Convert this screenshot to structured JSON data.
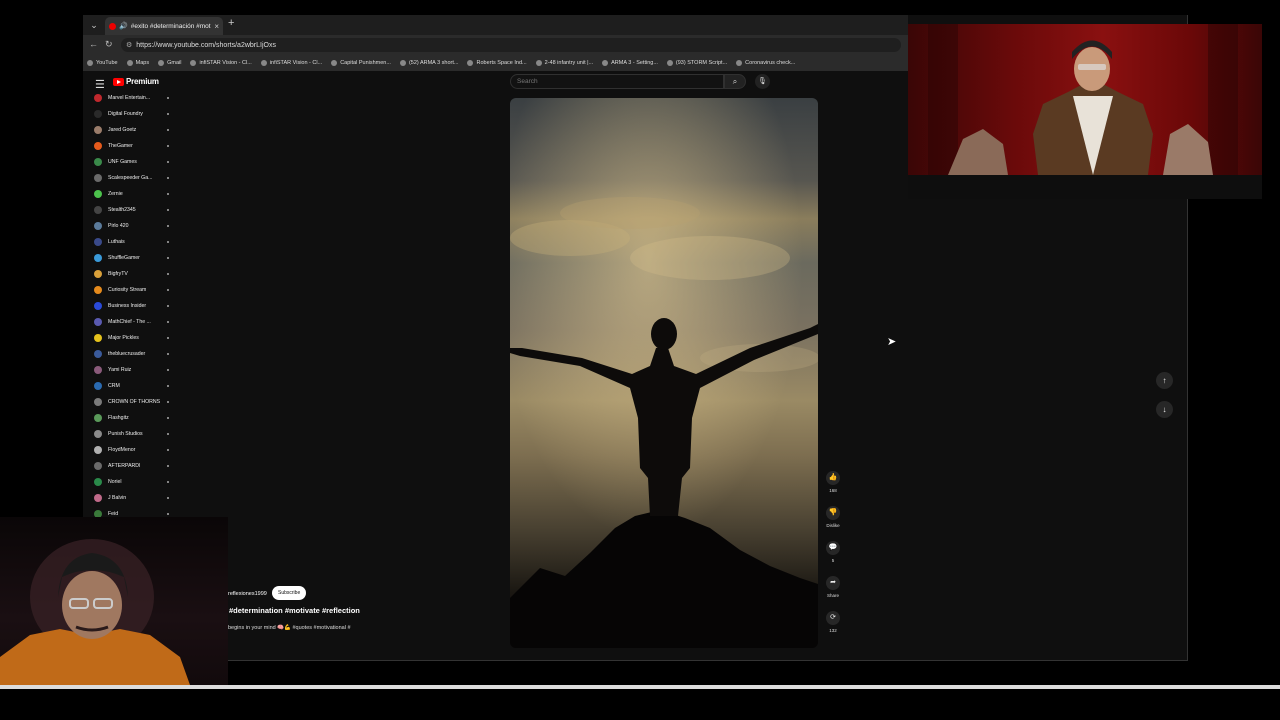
{
  "browser": {
    "tab_title": "#exito #determinación #moti",
    "url": "https://www.youtube.com/shorts/a2wbrLIjOxs",
    "bookmarks": [
      "YouTube",
      "Maps",
      "Gmail",
      "infiSTAR Vision - Cl...",
      "infiSTAR Vision - Cl...",
      "Capital Punishmen...",
      "(52) ARMA 3 short...",
      "Roberts Space Ind...",
      "2-48 infantry unit |...",
      "ARMA 3 - Setting...",
      "(93) STORM Script...",
      "Coronavirus check..."
    ]
  },
  "youtube": {
    "logo_text": "Premium",
    "search_placeholder": "Search",
    "sidebar": [
      {
        "name": "Marvel Entertain...",
        "color": "#c0282d"
      },
      {
        "name": "Digital Foundry",
        "color": "#2a2a2a"
      },
      {
        "name": "Jared Goetz",
        "color": "#9a7c6a"
      },
      {
        "name": "TheGamer",
        "color": "#e55a1c"
      },
      {
        "name": "UNF Games",
        "color": "#3a8a4a"
      },
      {
        "name": "Scalespeeder Ga...",
        "color": "#6a6a6a"
      },
      {
        "name": "Zernie",
        "color": "#4cc24c"
      },
      {
        "name": "Stealth2345",
        "color": "#444444"
      },
      {
        "name": "Pirlo 420",
        "color": "#5a7a9a"
      },
      {
        "name": "Luthais",
        "color": "#3a4a8a"
      },
      {
        "name": "ShuffleGamer",
        "color": "#3a9ad9"
      },
      {
        "name": "BigfryTV",
        "color": "#d9a03a"
      },
      {
        "name": "Curiosity Stream",
        "color": "#e58a1c"
      },
      {
        "name": "Business Insider",
        "color": "#2a4ad9"
      },
      {
        "name": "MathChief - The ...",
        "color": "#5a5ab0"
      },
      {
        "name": "Major Pickles",
        "color": "#e5c21c"
      },
      {
        "name": "thebluecrusader",
        "color": "#3a5a9a"
      },
      {
        "name": "Yami Ruiz",
        "color": "#8a5a7a"
      },
      {
        "name": "CRM",
        "color": "#2a6ab0"
      },
      {
        "name": "CROWN OF THORNS",
        "color": "#7a7a7a"
      },
      {
        "name": "Flashgitz",
        "color": "#5a9a5a"
      },
      {
        "name": "Punish Studios",
        "color": "#8a8a8a"
      },
      {
        "name": "FloydMenor",
        "color": "#b0b0b0"
      },
      {
        "name": "AFTERPARDI",
        "color": "#6a6a6a"
      },
      {
        "name": "Noriel",
        "color": "#2a8a4a"
      },
      {
        "name": "J Balvin",
        "color": "#c06a8a"
      },
      {
        "name": "Feid",
        "color": "#3a7a3a"
      }
    ],
    "short": {
      "channel": "reflexiones1999",
      "subscribe_label": "Subscribe",
      "title": "#determination #motivate #reflection",
      "description": "begins in your mind 🧠💪 #quotes #motivational #",
      "actions": [
        {
          "icon": "👍",
          "label": "168"
        },
        {
          "icon": "👎",
          "label": "Dislike"
        },
        {
          "icon": "💬",
          "label": "5"
        },
        {
          "icon": "➦",
          "label": "Share"
        },
        {
          "icon": "⟳",
          "label": "132"
        }
      ],
      "progress": 1.0
    }
  }
}
